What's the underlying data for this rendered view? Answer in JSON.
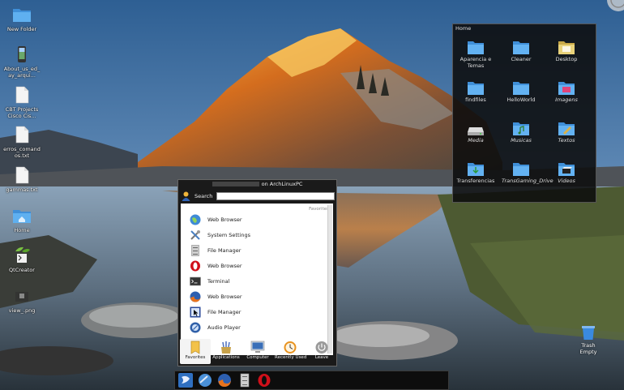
{
  "desktop": {
    "icons": [
      {
        "label": "New Folder",
        "icon": "folder-icon"
      },
      {
        "label": "About_us_ed_ay_arqui...",
        "icon": "phone-image-file-icon"
      },
      {
        "label": "CBT Projects Cisco Cis...",
        "icon": "text-file-icon"
      },
      {
        "label": "erros_comandos.txt",
        "icon": "text-file-icon"
      },
      {
        "label": "gammas.txt",
        "icon": "text-file-icon"
      },
      {
        "label": "Home",
        "icon": "home-folder-icon"
      },
      {
        "label": "QtCreator",
        "icon": "qtcreator-icon"
      },
      {
        "label": "view_.png",
        "icon": "image-file-icon"
      }
    ],
    "trash": {
      "label": "Trash Empty",
      "icon": "trash-icon"
    }
  },
  "home_window": {
    "title": "Home",
    "items": [
      {
        "label": "Aparencia e Temas",
        "italic": false,
        "icon": "folder-icon"
      },
      {
        "label": "Cleaner",
        "italic": false,
        "icon": "folder-icon"
      },
      {
        "label": "Desktop",
        "italic": false,
        "icon": "desktop-folder-icon"
      },
      {
        "label": "findfiles",
        "italic": false,
        "icon": "folder-icon"
      },
      {
        "label": "HelloWorld",
        "italic": false,
        "icon": "folder-icon"
      },
      {
        "label": "Imagens",
        "italic": true,
        "icon": "pictures-folder-icon"
      },
      {
        "label": "Media",
        "italic": true,
        "icon": "drive-icon"
      },
      {
        "label": "Musicas",
        "italic": true,
        "icon": "music-folder-icon"
      },
      {
        "label": "Textos",
        "italic": true,
        "icon": "documents-folder-icon"
      },
      {
        "label": "Transferencias",
        "italic": false,
        "icon": "downloads-folder-icon"
      },
      {
        "label": "TransGaming_Drive",
        "italic": true,
        "icon": "folder-icon"
      },
      {
        "label": "Videos",
        "italic": true,
        "icon": "videos-folder-icon"
      }
    ]
  },
  "menu": {
    "title_suffix": "on ArchLinuxPC",
    "search_label": "Search",
    "search_value": "",
    "section_label": "Favorites",
    "items": [
      {
        "label": "Web Browser",
        "icon": "globe-icon"
      },
      {
        "label": "System Settings",
        "icon": "settings-tools-icon"
      },
      {
        "label": "File Manager",
        "icon": "file-cabinet-icon"
      },
      {
        "label": "Web Browser",
        "icon": "opera-icon"
      },
      {
        "label": "Terminal",
        "icon": "terminal-icon"
      },
      {
        "label": "Web Browser",
        "icon": "firefox-icon"
      },
      {
        "label": "File Manager",
        "icon": "cursor-window-icon"
      },
      {
        "label": "Audio Player",
        "icon": "audio-player-icon"
      }
    ],
    "tabs": [
      {
        "label": "Favorites",
        "active": true
      },
      {
        "label": "Applications",
        "active": false
      },
      {
        "label": "Computer",
        "active": false
      },
      {
        "label": "Recently Used",
        "active": false
      },
      {
        "label": "Leave",
        "active": false
      }
    ]
  },
  "taskbar": {
    "buttons": [
      "kickoff-menu-icon",
      "globe-icon",
      "firefox-icon",
      "file-cabinet-icon",
      "opera-icon"
    ]
  },
  "colors": {
    "accent_blue": "#3b82d6",
    "folder_blue": "#4a9be0",
    "panel_bg": "#0d0d0d",
    "opera_red": "#d0101a",
    "firefox_orange": "#e8721c"
  }
}
